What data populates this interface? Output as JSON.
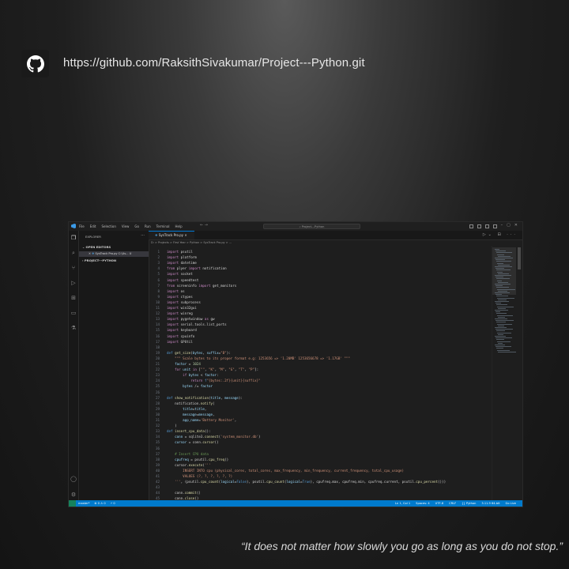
{
  "header": {
    "github_url": "https://github.com/RaksithSivakumar/Project---Python.git"
  },
  "quote": "“It does not matter how slowly you go as long as you do not stop.”",
  "vscode": {
    "menu": [
      "File",
      "Edit",
      "Selection",
      "View",
      "Go",
      "Run",
      "Terminal",
      "Help"
    ],
    "command_center": "Project---Python",
    "explorer_title": "EXPLORER",
    "open_editors": "OPEN EDITORS",
    "open_file": "SysTrack Pro.py  C:\\Us... U",
    "project_folder": "PROJECT---PYTHON",
    "tab_label": "SysTrack Pro.py",
    "breadcrumbs": "D: > Projects > First Year > Python > SysTrack Pro.py > ...",
    "code_lines": [
      {
        "n": "1",
        "html": "<span class='k'>import</span> psutil"
      },
      {
        "n": "2",
        "html": "<span class='k'>import</span> platform"
      },
      {
        "n": "3",
        "html": "<span class='k'>import</span> datetime"
      },
      {
        "n": "4",
        "html": "<span class='k'>from</span> plyer <span class='k'>import</span> notification"
      },
      {
        "n": "5",
        "html": "<span class='k'>import</span> socket"
      },
      {
        "n": "6",
        "html": "<span class='k'>import</span> speedtest"
      },
      {
        "n": "7",
        "html": "<span class='k'>from</span> screeninfo <span class='k'>import</span> get_monitors"
      },
      {
        "n": "8",
        "html": "<span class='k'>import</span> os"
      },
      {
        "n": "9",
        "html": "<span class='k'>import</span> ctypes"
      },
      {
        "n": "10",
        "html": "<span class='k'>import</span> subprocess"
      },
      {
        "n": "11",
        "html": "<span class='k'>import</span> win32gui"
      },
      {
        "n": "12",
        "html": "<span class='k'>import</span> winreg"
      },
      {
        "n": "13",
        "html": "<span class='k'>import</span> pygetwindow <span class='k'>as</span> gw"
      },
      {
        "n": "14",
        "html": "<span class='k'>import</span> serial.tools.list_ports"
      },
      {
        "n": "15",
        "html": "<span class='k'>import</span> keyboard"
      },
      {
        "n": "16",
        "html": "<span class='k'>import</span> cpuinfo"
      },
      {
        "n": "17",
        "html": "<span class='k'>import</span> GPUtil"
      },
      {
        "n": "18",
        "html": ""
      },
      {
        "n": "19",
        "html": "<span class='d'>def</span> <span class='f'>get_size</span>(<span class='v'>bytes</span>, <span class='v'>suffix</span>=<span class='s'>\"B\"</span>):"
      },
      {
        "n": "20",
        "html": "    <span class='s'>\"\"\" Scale bytes to its proper format e.g: 1253656 => '1.20MB' 1253656678 => '1.17GB' \"\"\"</span>"
      },
      {
        "n": "21",
        "html": "    <span class='v'>factor</span> = <span class='n'>1024</span>"
      },
      {
        "n": "22",
        "html": "    <span class='k'>for</span> <span class='v'>unit</span> <span class='k'>in</span> [<span class='s'>\"\"</span>, <span class='s'>\"K\"</span>, <span class='s'>\"M\"</span>, <span class='s'>\"G\"</span>, <span class='s'>\"T\"</span>, <span class='s'>\"P\"</span>]:"
      },
      {
        "n": "23",
        "html": "        <span class='k'>if</span> <span class='v'>bytes</span> &lt; <span class='v'>factor</span>:"
      },
      {
        "n": "24",
        "html": "            <span class='k'>return</span> <span class='d'>f</span><span class='s'>\"{bytes:.2f}{unit}{suffix}\"</span>"
      },
      {
        "n": "25",
        "html": "        <span class='v'>bytes</span> /= <span class='v'>factor</span>"
      },
      {
        "n": "26",
        "html": ""
      },
      {
        "n": "27",
        "html": "<span class='d'>def</span> <span class='f'>show_notification</span>(<span class='v'>title</span>, <span class='v'>message</span>):"
      },
      {
        "n": "28",
        "html": "    notification.<span class='f'>notify</span>("
      },
      {
        "n": "29",
        "html": "        <span class='v'>title</span>=<span class='v'>title</span>,"
      },
      {
        "n": "30",
        "html": "        <span class='v'>message</span>=<span class='v'>message</span>,"
      },
      {
        "n": "31",
        "html": "        <span class='v'>app_name</span>=<span class='s'>'Battery Monitor'</span>,"
      },
      {
        "n": "32",
        "html": "    )"
      },
      {
        "n": "33",
        "html": "<span class='d'>def</span> <span class='f'>insert_cpu_data</span>():"
      },
      {
        "n": "34",
        "html": "    <span class='v'>conn</span> = sqlite3.<span class='f'>connect</span>(<span class='s'>'system_monitor.db'</span>)"
      },
      {
        "n": "35",
        "html": "    <span class='v'>cursor</span> = conn.<span class='f'>cursor</span>()"
      },
      {
        "n": "36",
        "html": ""
      },
      {
        "n": "37",
        "html": "    <span class='c'># Insert CPU data</span>"
      },
      {
        "n": "38",
        "html": "    <span class='v'>cpufreq</span> = psutil.<span class='f'>cpu_freq</span>()"
      },
      {
        "n": "39",
        "html": "    cursor.<span class='f'>execute</span>(<span class='s'>'''</span>"
      },
      {
        "n": "40",
        "html": "<span class='s'>        INSERT INTO cpu (physical_cores, total_cores, max_frequency, min_frequency, current_frequency, total_cpu_usage)</span>"
      },
      {
        "n": "41",
        "html": "<span class='s'>        VALUES (?, ?, ?, ?, ?, ?)</span>"
      },
      {
        "n": "42",
        "html": "    <span class='s'>'''</span>, (psutil.<span class='f'>cpu_count</span>(<span class='v'>logical</span>=<span class='d'>False</span>), psutil.<span class='f'>cpu_count</span>(<span class='v'>logical</span>=<span class='d'>True</span>), cpufreq.max, cpufreq.min, cpufreq.current, psutil.<span class='f'>cpu_percent</span>()))"
      },
      {
        "n": "43",
        "html": ""
      },
      {
        "n": "44",
        "html": "    conn.<span class='f'>commit</span>()"
      },
      {
        "n": "45",
        "html": "    conn.<span class='f'>close</span>()"
      }
    ],
    "status_left": [
      "master*",
      "⊗ 0 ⚠ 0",
      "⚡ 0"
    ],
    "status_right": [
      "Ln 1, Col 1",
      "Spaces: 4",
      "UTF-8",
      "CRLF",
      "{} Python",
      "3.11.9 64-bit",
      "Go Live"
    ]
  }
}
